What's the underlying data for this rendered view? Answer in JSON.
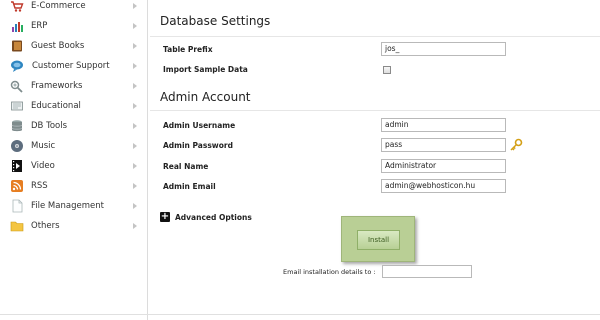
{
  "sidebar": {
    "items": [
      {
        "label": "E-Commerce",
        "icon": "shopping-cart-icon"
      },
      {
        "label": "ERP",
        "icon": "bar-chart-icon"
      },
      {
        "label": "Guest Books",
        "icon": "book-icon"
      },
      {
        "label": "Customer Support",
        "icon": "support-icon"
      },
      {
        "label": "Frameworks",
        "icon": "framework-icon"
      },
      {
        "label": "Educational",
        "icon": "education-icon"
      },
      {
        "label": "DB Tools",
        "icon": "database-icon"
      },
      {
        "label": "Music",
        "icon": "music-icon"
      },
      {
        "label": "Video",
        "icon": "film-icon"
      },
      {
        "label": "RSS",
        "icon": "rss-icon"
      },
      {
        "label": "File Management",
        "icon": "file-icon"
      },
      {
        "label": "Others",
        "icon": "folder-icon"
      }
    ]
  },
  "database_settings": {
    "title": "Database Settings",
    "table_prefix_label": "Table Prefix",
    "table_prefix_value": "jos_",
    "import_sample_label": "Import Sample Data",
    "import_sample_checked": false
  },
  "admin_account": {
    "title": "Admin Account",
    "username_label": "Admin Username",
    "username_value": "admin",
    "password_label": "Admin Password",
    "password_value": "pass",
    "realname_label": "Real Name",
    "realname_value": "Administrator",
    "email_label": "Admin Email",
    "email_value": "admin@webhosticon.hu"
  },
  "advanced": {
    "toggle_symbol": "+",
    "label": "Advanced Options"
  },
  "install": {
    "button_label": "Install",
    "email_details_label": "Email installation details to :",
    "email_details_value": ""
  },
  "colors": {
    "install_panel": "#b9cf95",
    "install_button_text": "#3a5a1f",
    "key_icon": "#d4a017"
  }
}
